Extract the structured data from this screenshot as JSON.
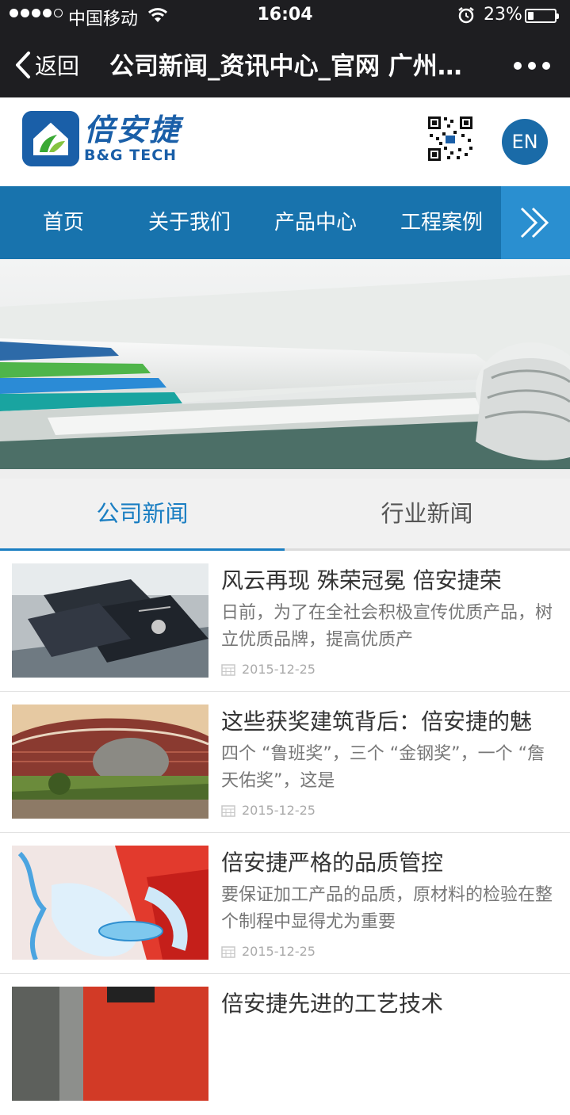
{
  "status": {
    "carrier": "中国移动",
    "time": "16:04",
    "battery_percent": "23%",
    "battery_level": 0.23,
    "signal_bars_filled": 4
  },
  "wechat_nav": {
    "back_label": "返回",
    "title": "公司新闻_资讯中心_官网 广州…"
  },
  "header": {
    "logo_cn": "倍安捷",
    "logo_en": "B&G TECH",
    "lang_button": "EN"
  },
  "main_nav": {
    "items": [
      {
        "label": "首页"
      },
      {
        "label": "关于我们"
      },
      {
        "label": "产品中心"
      },
      {
        "label": "工程案例"
      }
    ],
    "more_icon": "double-chevron-right-icon"
  },
  "tabs": [
    {
      "label": "公司新闻",
      "active": true
    },
    {
      "label": "行业新闻",
      "active": false
    }
  ],
  "news": [
    {
      "title": "风云再现 殊荣冠冕 倍安捷荣",
      "summary": "日前，为了在全社会积极宣传优质产品，树立优质品牌，提高优质产",
      "date": "2015-12-25"
    },
    {
      "title": "这些获奖建筑背后：倍安捷的魅",
      "summary": "四个 “鲁班奖”，三个 “金钢奖”，一个 “詹天佑奖”，这是",
      "date": "2015-12-25"
    },
    {
      "title": "倍安捷严格的品质管控",
      "summary": "要保证加工产品的品质，原材料的检验在整个制程中显得尤为重要",
      "date": "2015-12-25"
    },
    {
      "title": "倍安捷先进的工艺技术",
      "summary": "",
      "date": ""
    }
  ],
  "colors": {
    "brand_blue": "#1873ad",
    "tab_active": "#1a7ec2",
    "nav_dark": "#1e1e21"
  }
}
